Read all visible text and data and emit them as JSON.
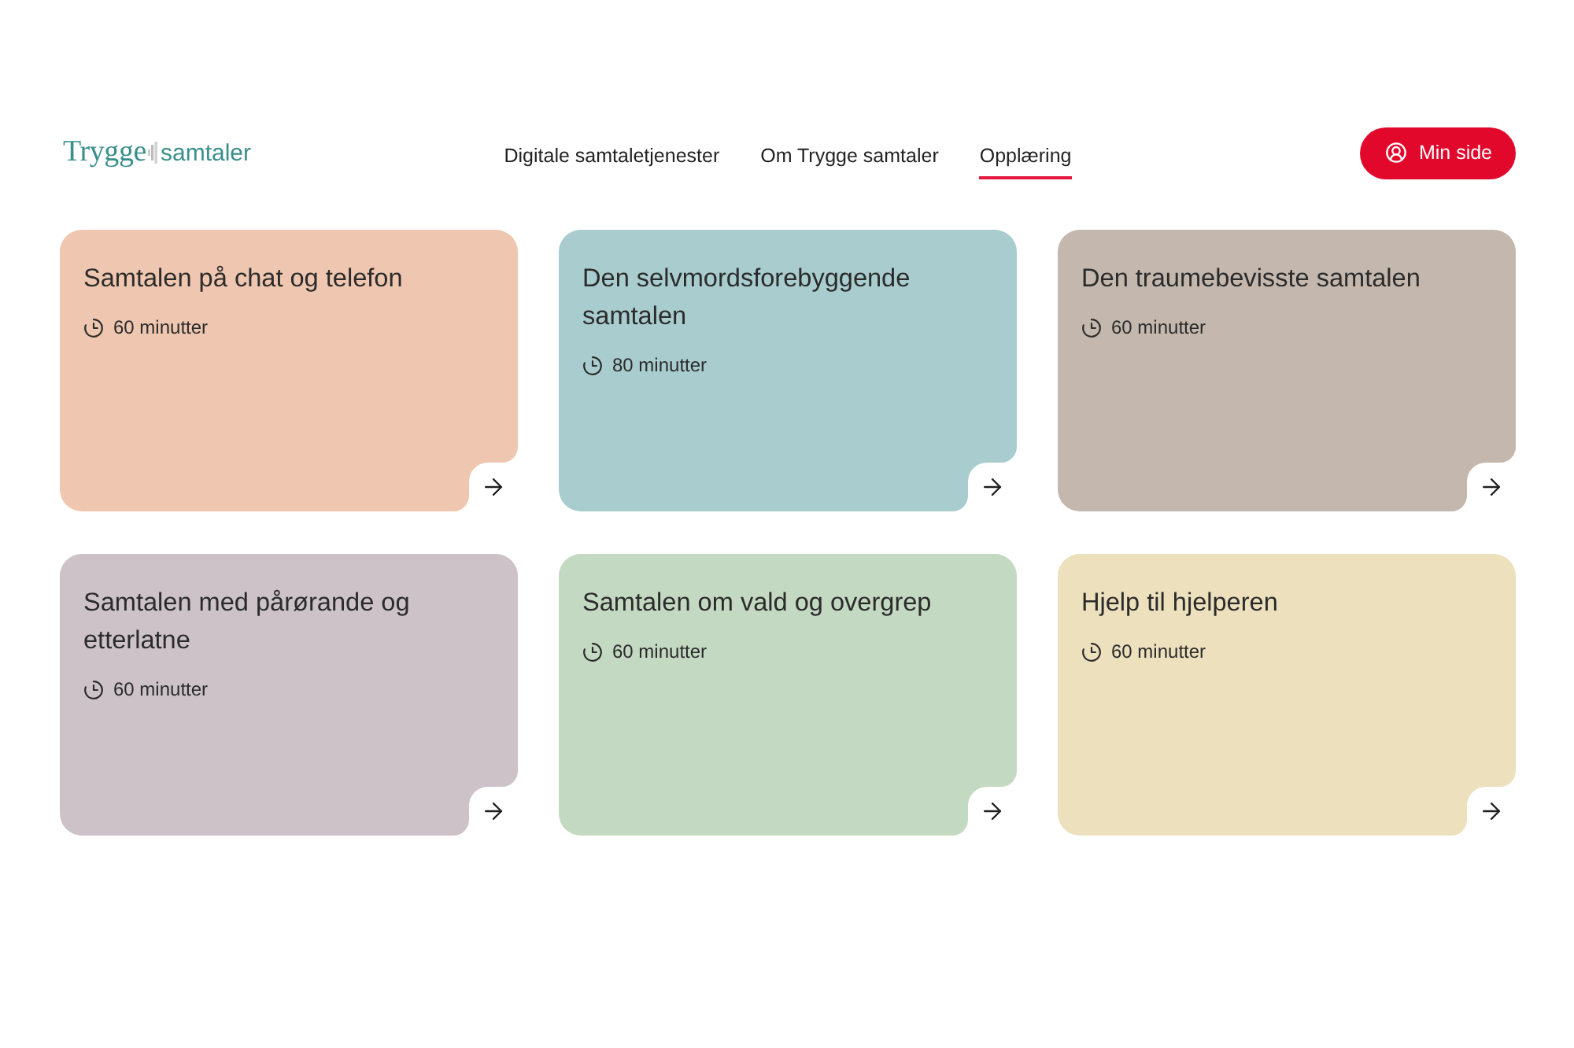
{
  "header": {
    "logo": {
      "word_1": "Trygge",
      "word_2": "samtaler"
    },
    "nav": [
      {
        "label": "Digitale samtaletjenester",
        "selected": false
      },
      {
        "label": "Om Trygge samtaler",
        "selected": false
      },
      {
        "label": "Opplæring",
        "selected": true
      }
    ],
    "account_button": {
      "label": "Min side"
    }
  },
  "courses": [
    {
      "title": "Samtalen på chat og telefon",
      "duration": "60 minutter",
      "color": "#efc7b0"
    },
    {
      "title": "Den selvmordsforebyggende samtalen",
      "duration": "80 minutter",
      "color": "#a9cdcf"
    },
    {
      "title": "Den traumebevisste samtalen",
      "duration": "60 minutter",
      "color": "#c4b8ae"
    },
    {
      "title": "Samtalen med pårørande og etterlatne",
      "duration": "60 minutter",
      "color": "#ccc2c8"
    },
    {
      "title": "Samtalen om vald og overgrep",
      "duration": "60 minutter",
      "color": "#c4d9c2"
    },
    {
      "title": "Hjelp til hjelperen",
      "duration": "60 minutter",
      "color": "#ece0bd"
    }
  ]
}
